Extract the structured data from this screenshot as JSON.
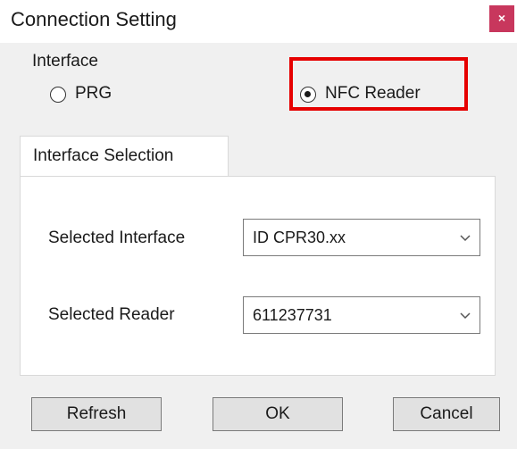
{
  "window": {
    "title": "Connection Setting",
    "close_glyph": "×",
    "close_color": "#c8375d"
  },
  "interface": {
    "group_label": "Interface",
    "options": [
      {
        "label": "PRG",
        "selected": false
      },
      {
        "label": "NFC Reader",
        "selected": true
      }
    ],
    "highlight_color": "#e60000"
  },
  "tabs": [
    {
      "label": "Interface Selection",
      "active": true
    }
  ],
  "fields": {
    "selected_interface": {
      "label": "Selected Interface",
      "value": "ID CPR30.xx"
    },
    "selected_reader": {
      "label": "Selected Reader",
      "value": "611237731"
    }
  },
  "buttons": {
    "refresh": "Refresh",
    "ok": "OK",
    "cancel": "Cancel"
  },
  "icons": {
    "close": "close-icon",
    "dropdown": "chevron-down-icon"
  }
}
